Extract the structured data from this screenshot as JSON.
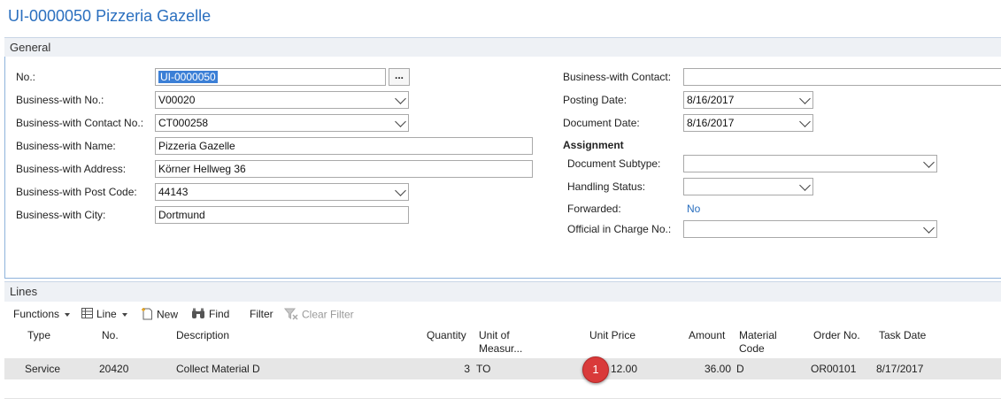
{
  "page": {
    "title": "UI-0000050 Pizzeria Gazelle"
  },
  "general": {
    "header": "General",
    "left": {
      "no_label": "No.:",
      "no_value": "UI-0000050",
      "assist_label": "...",
      "bw_no_label": "Business-with No.:",
      "bw_no_value": "V00020",
      "bw_contact_no_label": "Business-with Contact No.:",
      "bw_contact_no_value": "CT000258",
      "bw_name_label": "Business-with Name:",
      "bw_name_value": "Pizzeria Gazelle",
      "bw_address_label": "Business-with Address:",
      "bw_address_value": "Körner Hellweg 36",
      "bw_post_code_label": "Business-with Post Code:",
      "bw_post_code_value": "44143",
      "bw_city_label": "Business-with City:",
      "bw_city_value": "Dortmund"
    },
    "right": {
      "bw_contact_label": "Business-with Contact:",
      "bw_contact_value": "",
      "posting_date_label": "Posting Date:",
      "posting_date_value": "8/16/2017",
      "document_date_label": "Document Date:",
      "document_date_value": "8/16/2017",
      "assignment_label": "Assignment",
      "doc_subtype_label": "Document Subtype:",
      "doc_subtype_value": "",
      "handling_status_label": "Handling Status:",
      "handling_status_value": "",
      "forwarded_label": "Forwarded:",
      "forwarded_value": "No",
      "official_label": "Official in Charge No.:",
      "official_value": ""
    }
  },
  "lines": {
    "header": "Lines",
    "toolbar": {
      "functions": "Functions",
      "line": "Line",
      "new": "New",
      "find": "Find",
      "filter": "Filter",
      "clear_filter": "Clear Filter"
    },
    "columns": {
      "type": "Type",
      "no": "No.",
      "description": "Description",
      "quantity": "Quantity",
      "unit_of_measure_1": "Unit of",
      "unit_of_measure_2": "Measur...",
      "unit_price": "Unit Price",
      "amount": "Amount",
      "material_code_1": "Material",
      "material_code_2": "Code",
      "order_no": "Order No.",
      "task_date": "Task Date"
    },
    "rows": [
      {
        "type": "Service",
        "no": "20420",
        "description": "Collect Material D",
        "quantity": "3",
        "unit_of_measure": "TO",
        "unit_price": "12.00",
        "amount": "36.00",
        "material_code": "D",
        "order_no": "OR00101",
        "task_date": "8/17/2017"
      }
    ],
    "callout_badge": "1"
  },
  "colors": {
    "accent": "#2a6fbf",
    "badge": "#d93a3a",
    "selected_row": "#e6e6e6"
  }
}
